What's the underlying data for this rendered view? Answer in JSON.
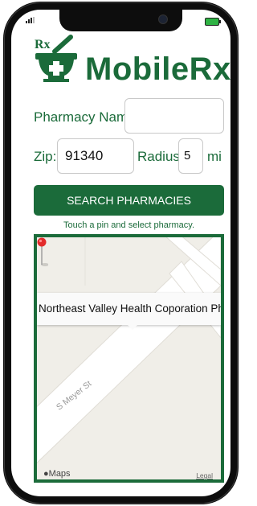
{
  "app": {
    "logo_rx": "Rx",
    "brand_name": "MobileRx"
  },
  "form": {
    "pharmacy_name_label": "Pharmacy Name:",
    "pharmacy_name_value": "",
    "zip_label": "Zip:",
    "zip_value": "91340",
    "radius_label": "Radius:",
    "radius_value": "5",
    "radius_unit": "mi",
    "search_button_label": "SEARCH PHARMACIES",
    "hint": "Touch a pin and select pharmacy."
  },
  "map": {
    "popup_text": "Northeast Valley Health Coporation Phar...",
    "street_label": "S Meyer St",
    "provider_label": "Maps",
    "legal_label": "Legal"
  },
  "colors": {
    "brand_green": "#1b6b3a",
    "pin_red": "#e32b2b",
    "battery_green": "#2fb344"
  }
}
